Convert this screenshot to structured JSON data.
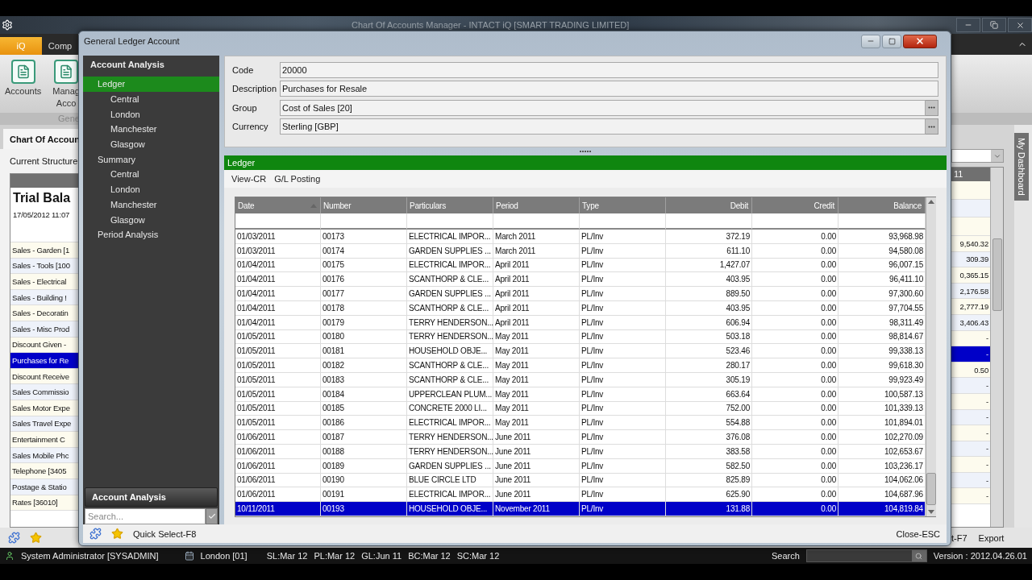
{
  "app": {
    "title": "Chart Of Accounts Manager - INTACT iQ [SMART TRADING LIMITED]",
    "ribbon_tabs": [
      {
        "label": "iQ",
        "selected": true
      },
      {
        "label": "Comp",
        "selected": false
      }
    ],
    "ribbon_buttons": [
      {
        "lines": [
          "Accounts"
        ]
      },
      {
        "lines": [
          "Manag",
          "Acco"
        ]
      }
    ],
    "ribbon_group": "Gene",
    "document_tab": "Chart Of Accoun",
    "structure_label": "Current Structure",
    "report_title": "Trial Bala",
    "report_date": "17/05/2012 11:07",
    "value_header": "11",
    "accounts": [
      {
        "name": "Sales - Garden [1",
        "value": "9,540.32",
        "selected": false
      },
      {
        "name": "Sales - Tools [100",
        "value": "309.39",
        "selected": false
      },
      {
        "name": "Sales - Electrical",
        "value": "0,365.15",
        "selected": false
      },
      {
        "name": "Sales - Building !",
        "value": "2,176.58",
        "selected": false
      },
      {
        "name": "Sales - Decoratin",
        "value": "2,777.19",
        "selected": false
      },
      {
        "name": "Sales - Misc Prod",
        "value": "3,406.43",
        "selected": false
      },
      {
        "name": "Discount Given -",
        "value": "-",
        "selected": false
      },
      {
        "name": "Purchases for Re",
        "value": "-",
        "selected": true
      },
      {
        "name": "Discount Receive",
        "value": "0.50",
        "selected": false
      },
      {
        "name": "Sales Commissio",
        "value": "-",
        "selected": false
      },
      {
        "name": "Sales Motor Expe",
        "value": "-",
        "selected": false
      },
      {
        "name": "Sales Travel Expe",
        "value": "-",
        "selected": false
      },
      {
        "name": "Entertainment C",
        "value": "-",
        "selected": false
      },
      {
        "name": "Sales Mobile Phc",
        "value": "-",
        "selected": false
      },
      {
        "name": "Telephone [3405",
        "value": "-",
        "selected": false
      },
      {
        "name": "Postage & Statio",
        "value": "-",
        "selected": false
      },
      {
        "name": "Rates [36010]",
        "value": "-",
        "selected": false
      }
    ],
    "dashboard_tab": "My Dashboard",
    "bottom_actions": [
      "t-F7",
      "Export"
    ]
  },
  "dialog": {
    "title": "General Ledger Account",
    "nav": {
      "header": "Account Analysis",
      "tree": [
        {
          "label": "Ledger",
          "selected": true,
          "children": [
            {
              "label": "Central",
              "selected": false
            },
            {
              "label": "London",
              "selected": false
            },
            {
              "label": "Manchester",
              "selected": false
            },
            {
              "label": "Glasgow",
              "selected": false
            }
          ]
        },
        {
          "label": "Summary",
          "selected": false,
          "children": [
            {
              "label": "Central",
              "selected": false
            },
            {
              "label": "London",
              "selected": false
            },
            {
              "label": "Manchester",
              "selected": false
            },
            {
              "label": "Glasgow",
              "selected": false
            }
          ]
        },
        {
          "label": "Period Analysis",
          "selected": false
        }
      ],
      "footer_button": "Account Analysis",
      "search_placeholder": "Search..."
    },
    "fields": [
      {
        "label": "Code",
        "value": "20000",
        "kind": "text"
      },
      {
        "label": "Description",
        "value": "Purchases for Resale",
        "kind": "text"
      },
      {
        "label": "Group",
        "value": "Cost of Sales [20]",
        "kind": "lookup"
      },
      {
        "label": "Currency",
        "value": "Sterling [GBP]",
        "kind": "lookup"
      }
    ],
    "section_title": "Ledger",
    "toolbar": [
      "View-CR",
      "G/L Posting"
    ],
    "table": {
      "columns": [
        {
          "label": "Date",
          "numeric": false,
          "sorted": true
        },
        {
          "label": "Number",
          "numeric": false,
          "sorted": false
        },
        {
          "label": "Particulars",
          "numeric": false,
          "sorted": false
        },
        {
          "label": "Period",
          "numeric": false,
          "sorted": false
        },
        {
          "label": "Type",
          "numeric": false,
          "sorted": false
        },
        {
          "label": "Debit",
          "numeric": true,
          "sorted": false
        },
        {
          "label": "Credit",
          "numeric": true,
          "sorted": false
        },
        {
          "label": "Balance",
          "numeric": true,
          "sorted": false
        }
      ],
      "rows": [
        {
          "cells": [
            "01/03/2011",
            "00173",
            "ELECTRICAL IMPOR...",
            "March 2011",
            "PL/Inv",
            "372.19",
            "0.00",
            "93,968.98"
          ],
          "selected": false
        },
        {
          "cells": [
            "01/03/2011",
            "00174",
            "GARDEN SUPPLIES ...",
            "March 2011",
            "PL/Inv",
            "611.10",
            "0.00",
            "94,580.08"
          ],
          "selected": false
        },
        {
          "cells": [
            "01/04/2011",
            "00175",
            "ELECTRICAL IMPOR...",
            "April 2011",
            "PL/Inv",
            "1,427.07",
            "0.00",
            "96,007.15"
          ],
          "selected": false
        },
        {
          "cells": [
            "01/04/2011",
            "00176",
            "SCANTHORP & CLE...",
            "April 2011",
            "PL/Inv",
            "403.95",
            "0.00",
            "96,411.10"
          ],
          "selected": false
        },
        {
          "cells": [
            "01/04/2011",
            "00177",
            "GARDEN SUPPLIES ...",
            "April 2011",
            "PL/Inv",
            "889.50",
            "0.00",
            "97,300.60"
          ],
          "selected": false
        },
        {
          "cells": [
            "01/04/2011",
            "00178",
            "SCANTHORP & CLE...",
            "April 2011",
            "PL/Inv",
            "403.95",
            "0.00",
            "97,704.55"
          ],
          "selected": false
        },
        {
          "cells": [
            "01/04/2011",
            "00179",
            "TERRY HENDERSON...",
            "April 2011",
            "PL/Inv",
            "606.94",
            "0.00",
            "98,311.49"
          ],
          "selected": false
        },
        {
          "cells": [
            "01/05/2011",
            "00180",
            "TERRY HENDERSON...",
            "May 2011",
            "PL/Inv",
            "503.18",
            "0.00",
            "98,814.67"
          ],
          "selected": false
        },
        {
          "cells": [
            "01/05/2011",
            "00181",
            "HOUSEHOLD OBJE...",
            "May 2011",
            "PL/Inv",
            "523.46",
            "0.00",
            "99,338.13"
          ],
          "selected": false
        },
        {
          "cells": [
            "01/05/2011",
            "00182",
            "SCANTHORP & CLE...",
            "May 2011",
            "PL/Inv",
            "280.17",
            "0.00",
            "99,618.30"
          ],
          "selected": false
        },
        {
          "cells": [
            "01/05/2011",
            "00183",
            "SCANTHORP & CLE...",
            "May 2011",
            "PL/Inv",
            "305.19",
            "0.00",
            "99,923.49"
          ],
          "selected": false
        },
        {
          "cells": [
            "01/05/2011",
            "00184",
            "UPPERCLEAN PLUM...",
            "May 2011",
            "PL/Inv",
            "663.64",
            "0.00",
            "100,587.13"
          ],
          "selected": false
        },
        {
          "cells": [
            "01/05/2011",
            "00185",
            "CONCRETE 2000 LI...",
            "May 2011",
            "PL/Inv",
            "752.00",
            "0.00",
            "101,339.13"
          ],
          "selected": false
        },
        {
          "cells": [
            "01/05/2011",
            "00186",
            "ELECTRICAL IMPOR...",
            "May 2011",
            "PL/Inv",
            "554.88",
            "0.00",
            "101,894.01"
          ],
          "selected": false
        },
        {
          "cells": [
            "01/06/2011",
            "00187",
            "TERRY HENDERSON...",
            "June 2011",
            "PL/Inv",
            "376.08",
            "0.00",
            "102,270.09"
          ],
          "selected": false
        },
        {
          "cells": [
            "01/06/2011",
            "00188",
            "TERRY HENDERSON...",
            "June 2011",
            "PL/Inv",
            "383.58",
            "0.00",
            "102,653.67"
          ],
          "selected": false
        },
        {
          "cells": [
            "01/06/2011",
            "00189",
            "GARDEN SUPPLIES ...",
            "June 2011",
            "PL/Inv",
            "582.50",
            "0.00",
            "103,236.17"
          ],
          "selected": false
        },
        {
          "cells": [
            "01/06/2011",
            "00190",
            "BLUE CIRCLE LTD",
            "June 2011",
            "PL/Inv",
            "825.89",
            "0.00",
            "104,062.06"
          ],
          "selected": false
        },
        {
          "cells": [
            "01/06/2011",
            "00191",
            "ELECTRICAL IMPOR...",
            "June 2011",
            "PL/Inv",
            "625.90",
            "0.00",
            "104,687.96"
          ],
          "selected": false
        },
        {
          "cells": [
            "10/11/2011",
            "00193",
            "HOUSEHOLD OBJE...",
            "November 2011",
            "PL/Inv",
            "131.88",
            "0.00",
            "104,819.84"
          ],
          "selected": true
        }
      ]
    },
    "footer": {
      "quick_select": "Quick Select-F8",
      "close": "Close-ESC"
    }
  },
  "status_bar": {
    "user": "System Administrator [SYSADMIN]",
    "company": "London [01]",
    "periods": [
      "SL:Mar 12",
      "PL:Mar 12",
      "GL:Jun 11",
      "BC:Mar 12",
      "SC:Mar 12"
    ],
    "search_label": "Search",
    "version": "Version : 2012.04.26.01"
  }
}
